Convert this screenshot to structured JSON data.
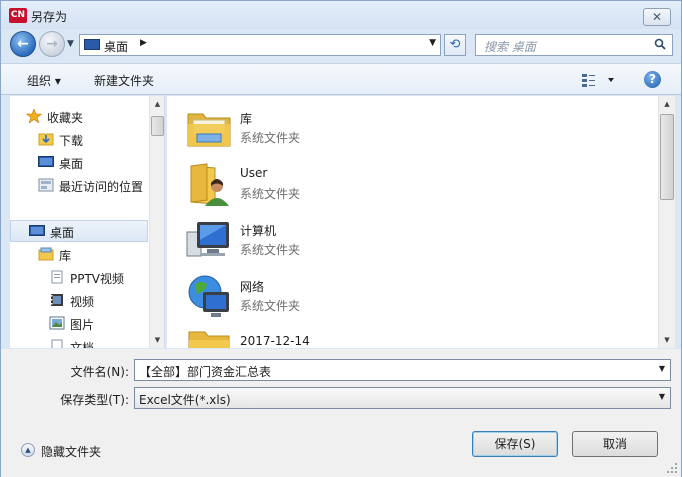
{
  "window": {
    "title": "另存为",
    "app_icon_text": "CN",
    "close_label": "✕"
  },
  "nav": {
    "address": "桌面",
    "search_placeholder": "搜索 桌面"
  },
  "toolbar": {
    "organize": "组织 ▾",
    "new_folder": "新建文件夹",
    "help": "?"
  },
  "sidebar": {
    "items": [
      {
        "label": "收藏夹",
        "icon": "star-icon"
      },
      {
        "label": "下载",
        "icon": "download-folder-icon"
      },
      {
        "label": "桌面",
        "icon": "desktop-icon"
      },
      {
        "label": "最近访问的位置",
        "icon": "recent-places-icon"
      },
      {
        "label": "桌面",
        "icon": "desktop-icon",
        "selected": true
      },
      {
        "label": "库",
        "icon": "library-icon"
      },
      {
        "label": "PPTV视频",
        "icon": "video-library-icon"
      },
      {
        "label": "视频",
        "icon": "video-icon"
      },
      {
        "label": "图片",
        "icon": "picture-icon"
      },
      {
        "label": "文档",
        "icon": "document-icon"
      }
    ]
  },
  "files": [
    {
      "name": "库",
      "type": "系统文件夹",
      "icon": "library-folder-icon"
    },
    {
      "name": "User",
      "type": "系统文件夹",
      "icon": "user-folder-icon"
    },
    {
      "name": "计算机",
      "type": "系统文件夹",
      "icon": "computer-icon"
    },
    {
      "name": "网络",
      "type": "系统文件夹",
      "icon": "network-icon"
    },
    {
      "name": "2017-12-14",
      "type": "",
      "icon": "folder-icon"
    }
  ],
  "form": {
    "filename_label": "文件名(N):",
    "filename_value": "【全部】部门资金汇总表",
    "filetype_label": "保存类型(T):",
    "filetype_value": "Excel文件(*.xls)",
    "hide_folders": "隐藏文件夹",
    "save": "保存(S)",
    "cancel": "取消"
  },
  "colors": {
    "accent": "#2a6cbf",
    "frame": "#dbe7f5",
    "folder": "#f2c94c"
  }
}
